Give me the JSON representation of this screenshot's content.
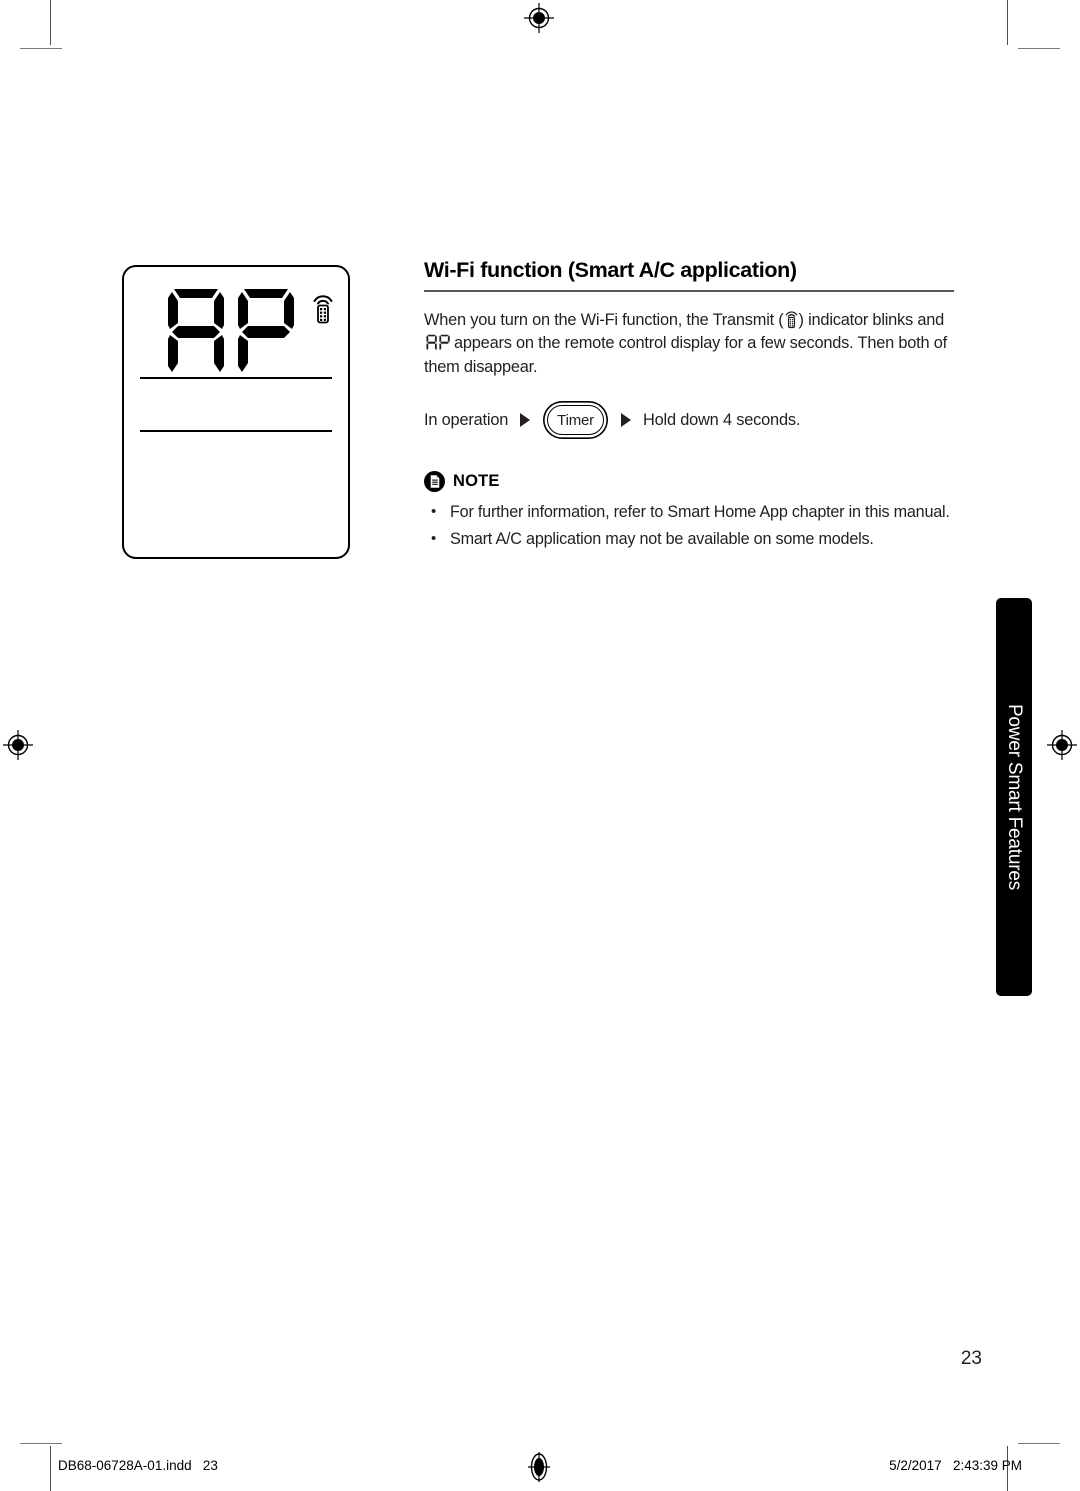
{
  "document": {
    "section": {
      "title": "Wi-Fi function (Smart A/C application)",
      "paragraph_part1": "When you turn on the Wi-Fi function, the Transmit (",
      "paragraph_part2": ") indicator blinks and",
      "paragraph_part3": "appears on the remote control display for a few seconds. Then both of them disappear.",
      "transmit_icon": "transmit-icon",
      "display_code": "AP"
    },
    "operation": {
      "prefix_label": "In operation",
      "arrow_icon": "right-triangle-icon",
      "button_label": "Timer",
      "suffix_label": "Hold down 4 seconds."
    },
    "note": {
      "icon": "note-document-icon",
      "label": "NOTE",
      "items": [
        "For further information, refer to Smart Home App chapter in this manual.",
        "Smart A/C application may not be available on some models."
      ]
    },
    "figure": {
      "name": "remote-control-lcd-display",
      "segment_text": "AP",
      "transmit_icon": "transmit-icon"
    },
    "side_tab": {
      "label": "Power Smart Features",
      "background": "#000000",
      "text_color": "#ffffff"
    },
    "page_number": "23",
    "footer": {
      "file_name": "DB68-06728A-01.indd   23",
      "timestamp": "5/2/2017   2:43:39 PM"
    },
    "marks": {
      "registration_icon": "registration-target-icon",
      "crop_icon": "crop-mark-icon"
    }
  }
}
